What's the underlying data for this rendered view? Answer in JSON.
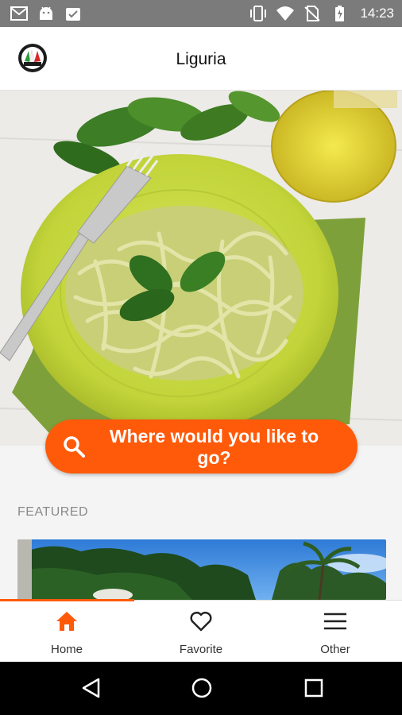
{
  "status_bar": {
    "time": "14:23",
    "icons": [
      "gmail-icon",
      "android-icon",
      "clipboard-icon",
      "vibrate-icon",
      "wifi-icon",
      "no-sim-icon",
      "battery-charging-icon"
    ]
  },
  "app_bar": {
    "title": "Liguria",
    "logo_icon": "italy-flag-badge-icon"
  },
  "search": {
    "label": "Where would you like to go?",
    "icon": "search-icon"
  },
  "featured": {
    "label": "FEATURED"
  },
  "bottom_nav": {
    "items": [
      {
        "label": "Home",
        "icon": "home-icon",
        "active": true
      },
      {
        "label": "Favorite",
        "icon": "heart-icon",
        "active": false
      },
      {
        "label": "Other",
        "icon": "menu-icon",
        "active": false
      }
    ]
  },
  "system_nav": {
    "icons": [
      "back-icon",
      "home-circle-icon",
      "recents-icon"
    ]
  },
  "colors": {
    "accent": "#ff5a0a",
    "status_bar": "#7b7b7b"
  }
}
